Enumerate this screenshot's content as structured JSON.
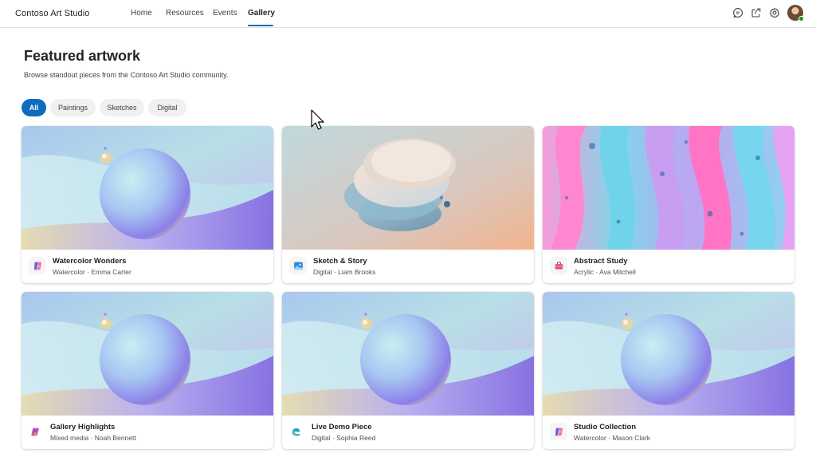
{
  "app": {
    "name": "Contoso Art Studio"
  },
  "nav": {
    "items": [
      {
        "label": "Home",
        "active": false
      },
      {
        "label": "Resources",
        "active": false
      },
      {
        "label": "Events",
        "active": false
      },
      {
        "label": "Gallery",
        "active": true
      }
    ]
  },
  "header_icons": [
    "chat-icon",
    "share-icon",
    "settings-icon",
    "avatar"
  ],
  "page": {
    "title": "Featured artwork",
    "subtitle": "Browse standout pieces from the Contoso Art Studio community."
  },
  "filters": [
    {
      "label": "All",
      "selected": true
    },
    {
      "label": "Paintings",
      "selected": false
    },
    {
      "label": "Sketches",
      "selected": false
    },
    {
      "label": "Digital",
      "selected": false
    }
  ],
  "cards": [
    {
      "title": "Watercolor Wonders",
      "subtitle": "Watercolor · Emma Carter",
      "image": "abstract-sphere",
      "app_icon": "copilot-icon"
    },
    {
      "title": "Sketch & Story",
      "subtitle": "Digital · Liam Brooks",
      "image": "stacked-discs",
      "app_icon": "photos-icon"
    },
    {
      "title": "Abstract Study",
      "subtitle": "Acrylic · Ava Mitchell",
      "image": "fluid-paint",
      "app_icon": "toolbox-icon"
    },
    {
      "title": "Gallery Highlights",
      "subtitle": "Mixed media · Noah Bennett",
      "image": "abstract-sphere",
      "app_icon": "copilot-color-icon"
    },
    {
      "title": "Live Demo Piece",
      "subtitle": "Digital · Sophia Reed",
      "image": "abstract-sphere",
      "app_icon": "edge-icon"
    },
    {
      "title": "Studio Collection",
      "subtitle": "Watercolor · Mason Clark",
      "image": "abstract-sphere",
      "app_icon": "copilot-icon"
    }
  ],
  "colors": {
    "accent": "#0f6cbd",
    "chip_bg": "#f0f0f0",
    "presence": "#13a10e"
  }
}
